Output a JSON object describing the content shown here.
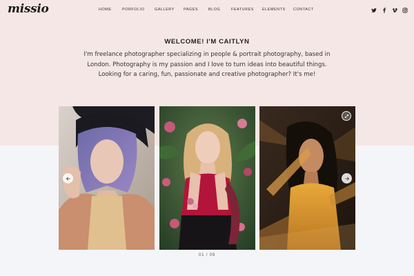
{
  "site": {
    "logo": "missio"
  },
  "nav": {
    "items": [
      {
        "label": "HOME"
      },
      {
        "label": "PORFOLIO"
      },
      {
        "label": "GALLERY"
      },
      {
        "label": "PAGES"
      },
      {
        "label": "BLOG"
      },
      {
        "label": "FEATURES"
      },
      {
        "label": "ELEMENTS"
      },
      {
        "label": "CONTACT"
      }
    ]
  },
  "social": [
    "twitter-icon",
    "facebook-icon",
    "vimeo-icon",
    "instagram-icon"
  ],
  "intro": {
    "title": "WELCOME! I'M CAITLYN",
    "lines": [
      "I'm freelance photographer specializing in people & portrait photography, based in",
      "London. Photography is my passion and I love to turn ideas into beautiful things.",
      "Looking for a caring, fun, passionate and creative photographer? It's me!"
    ]
  },
  "slider": {
    "current": "01",
    "separator": "/",
    "total": "09"
  },
  "colors": {
    "hero_bg": "#f5e7e6",
    "page_bg": "#f4f5f9"
  }
}
